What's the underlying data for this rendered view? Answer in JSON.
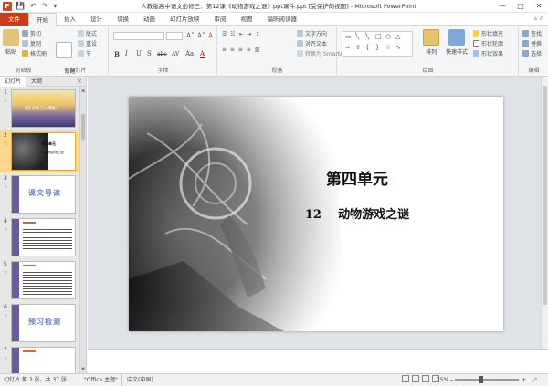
{
  "window": {
    "title": "人教版高中语文必修三：第12课《动物游戏之谜》ppt课件.ppt [受保护的视图] - Microsoft PowerPoint",
    "qat": [
      "💾",
      "↶",
      "↷",
      "▾"
    ],
    "controls": [
      "—",
      "□",
      "✕"
    ]
  },
  "tabs": [
    {
      "label": "文件"
    },
    {
      "label": "开始"
    },
    {
      "label": "插入"
    },
    {
      "label": "设计"
    },
    {
      "label": "切换"
    },
    {
      "label": "动画"
    },
    {
      "label": "幻灯片放映"
    },
    {
      "label": "审阅"
    },
    {
      "label": "视图"
    },
    {
      "label": "福昕阅读器"
    }
  ],
  "tabrow_right": "▵ ?",
  "ribbon": {
    "clipboard": {
      "label": "剪贴板",
      "paste": "粘贴",
      "cut": "剪切",
      "copy": "复制",
      "painter": "格式刷"
    },
    "slides": {
      "label": "幻灯片",
      "new_slide": "新建\n幻灯片",
      "layout": "版式",
      "reset": "重设",
      "section": "节"
    },
    "font": {
      "label": "字体",
      "font_name": "",
      "font_size": "",
      "grow": "A˄",
      "shrink": "A˅",
      "clear": "A",
      "bold": "B",
      "italic": "I",
      "underline": "U",
      "shadow": "S",
      "strike": "abc",
      "spacing": "AV",
      "case": "Aa",
      "color": "A"
    },
    "paragraph": {
      "label": "段落",
      "text_dir": "文字方向",
      "align_text": "对齐文本",
      "smartart": "转换为 SmartArt"
    },
    "drawing": {
      "label": "绘图",
      "arrange": "排列",
      "quick_styles": "快速样式",
      "fill": "形状填充",
      "outline": "形状轮廓",
      "effects": "形状效果"
    },
    "editing": {
      "label": "编辑",
      "find": "查找",
      "replace": "替换",
      "select": "选择"
    }
  },
  "left_pane": {
    "tabs": [
      "幻灯片",
      "大纲"
    ],
    "close": "×",
    "slides": [
      {
        "num": "1",
        "anim": "☆",
        "text": "YUWEN",
        "sub": "语文 必修(三)(人教版)"
      },
      {
        "num": "2",
        "anim": "☆",
        "text": "第四单元",
        "sub": "12 动物游戏之谜"
      },
      {
        "num": "3",
        "anim": "☆",
        "text": "课文导读",
        "sub": ""
      },
      {
        "num": "4",
        "anim": "☆",
        "text": "",
        "sub": ""
      },
      {
        "num": "5",
        "anim": "☆",
        "text": "",
        "sub": ""
      },
      {
        "num": "6",
        "anim": "☆",
        "text": "预习检测",
        "sub": ""
      },
      {
        "num": "7",
        "anim": "☆",
        "text": "",
        "sub": ""
      }
    ],
    "selected": 2
  },
  "slide": {
    "title": "第四单元",
    "subtitle": "12    动物游戏之谜"
  },
  "notes": {
    "placeholder": ""
  },
  "status": {
    "slide_info": "幻灯片 第 2 张，共 37 张",
    "theme": "\"Office 主题\"",
    "language": "中文(中国)",
    "zoom": "75%",
    "zoom_minus": "−",
    "zoom_plus": "+"
  },
  "colors": {
    "file_tab": "#c43e1c",
    "selected_thumb": "#fcd88f",
    "ribbon_bg": "#f5f6f7"
  }
}
